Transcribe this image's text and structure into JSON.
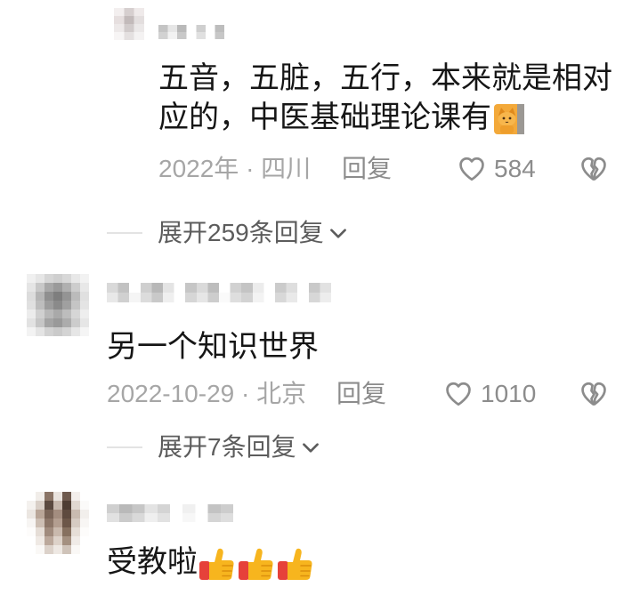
{
  "colors": {
    "background": "#ffffff",
    "comment_text": "#161616",
    "meta_text": "#a6a6a6",
    "action_text": "#8c8c8c",
    "expand_text": "#5c5c5c",
    "icon_stroke": "#8c8c8c",
    "divider": "#e3e3e3"
  },
  "comments": [
    {
      "text": "五音，五脏，五行，本来就是相对应的，中医基础理论课有",
      "emojis": [
        "cat-emoji"
      ],
      "meta": "2022年 · 四川",
      "reply_label": "回复",
      "like_icon": "heart-outline-icon",
      "like_count": "584",
      "dislike_icon": "broken-heart-icon",
      "expand_label": "展开259条回复",
      "expand_icon": "chevron-down-icon"
    },
    {
      "text": "另一个知识世界",
      "meta": "2022-10-29 · 北京",
      "reply_label": "回复",
      "like_icon": "heart-outline-icon",
      "like_count": "1010",
      "dislike_icon": "broken-heart-icon",
      "expand_label": "展开7条回复",
      "expand_icon": "chevron-down-icon"
    },
    {
      "text": "受教啦",
      "emojis": [
        "thumbs-up-emoji",
        "thumbs-up-emoji",
        "thumbs-up-emoji"
      ]
    }
  ]
}
